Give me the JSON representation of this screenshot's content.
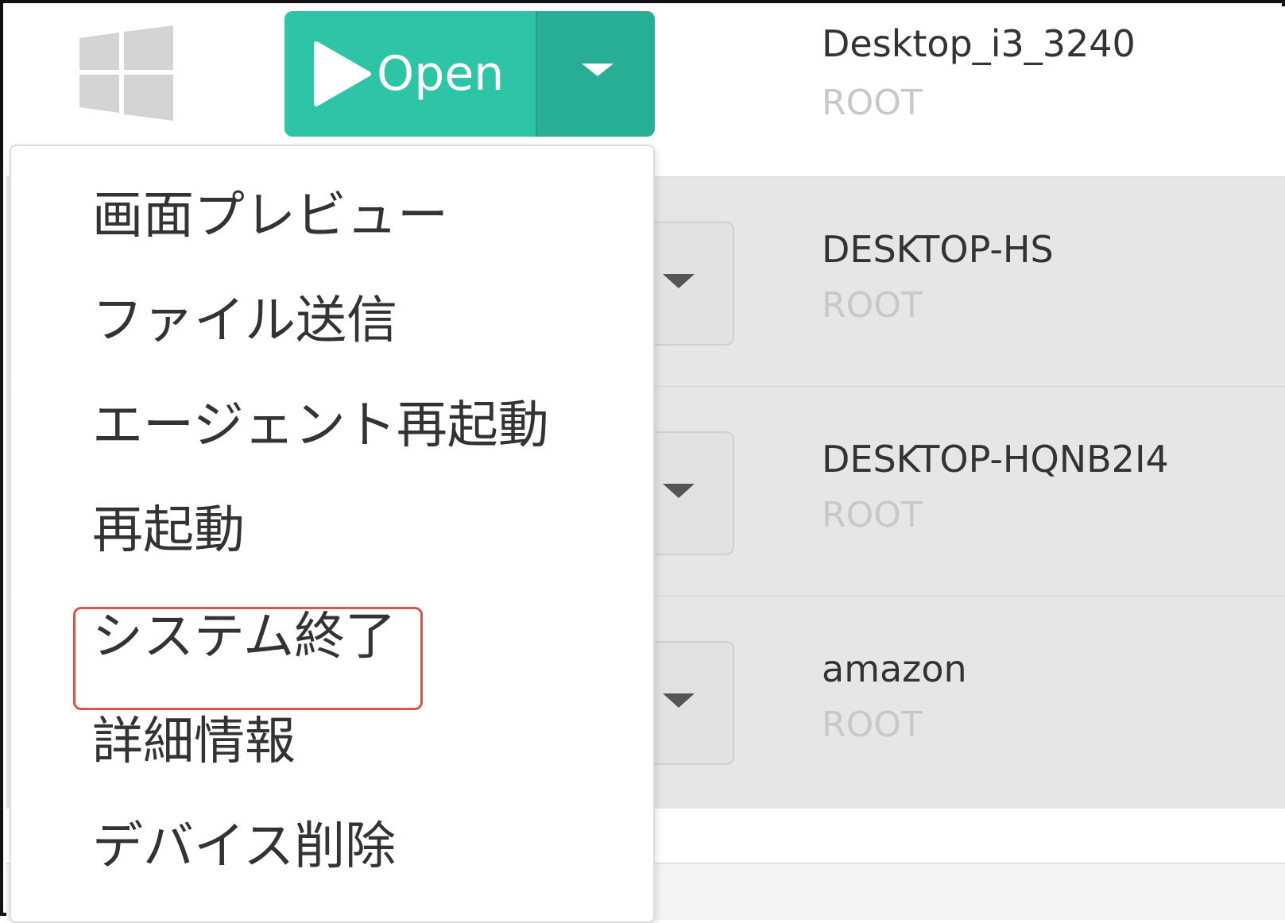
{
  "toolbar": {
    "os_icon": "windows-logo-icon",
    "open_button": {
      "icon": "play-icon",
      "label": "Open",
      "toggle_icon": "caret-down-icon",
      "color": "#2ec4a6"
    }
  },
  "devices": [
    {
      "name": "Desktop_i3_3240",
      "user": "ROOT"
    },
    {
      "name": "DESKTOP-HS",
      "user": "ROOT"
    },
    {
      "name": "DESKTOP-HQNB2I4",
      "user": "ROOT"
    },
    {
      "name": "amazon",
      "user": "ROOT"
    }
  ],
  "context_menu": {
    "items": [
      {
        "label": "画面プレビュー"
      },
      {
        "label": "ファイル送信"
      },
      {
        "label": "エージェント再起動"
      },
      {
        "label": "再起動"
      },
      {
        "label": "システム終了",
        "highlighted": true
      },
      {
        "label": "詳細情報"
      },
      {
        "label": "デバイス削除"
      }
    ],
    "highlight_color": "#d9534f"
  }
}
